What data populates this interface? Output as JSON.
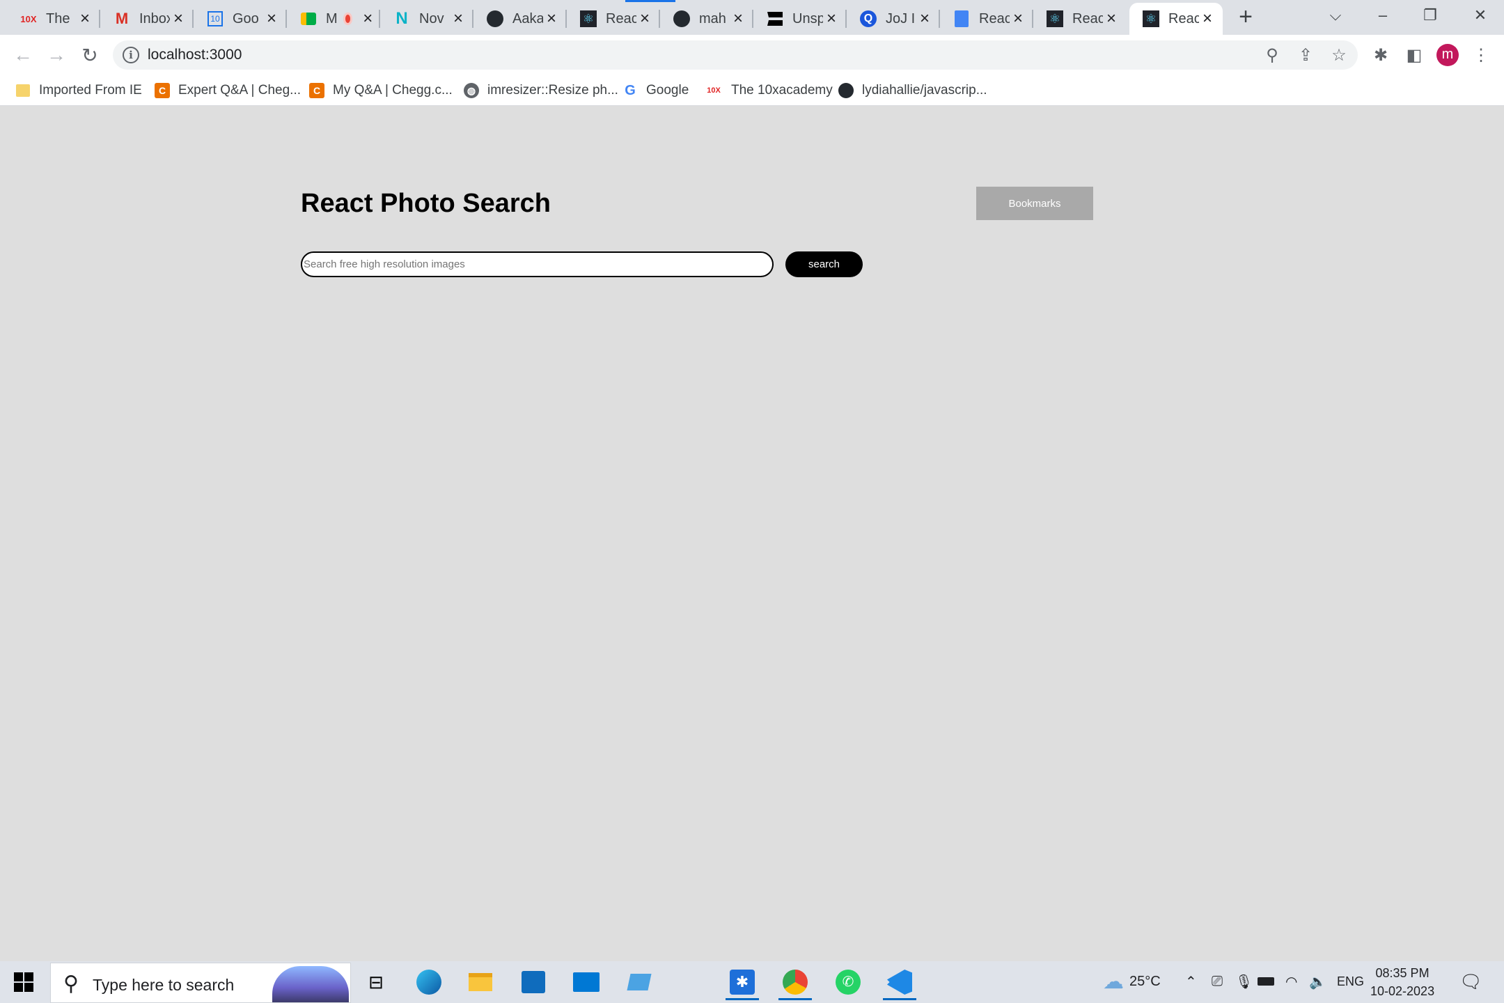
{
  "browser": {
    "tabs": [
      {
        "title": "The",
        "icon": "10x-logo-icon"
      },
      {
        "title": "Inbox",
        "icon": "gmail-icon"
      },
      {
        "title": "Goo",
        "icon": "google-calendar-icon"
      },
      {
        "title": "M",
        "icon": "google-meet-icon"
      },
      {
        "title": "Nov",
        "icon": "novu-icon"
      },
      {
        "title": "Aaka",
        "icon": "github-icon"
      },
      {
        "title": "Reac",
        "icon": "react-icon"
      },
      {
        "title": "mah",
        "icon": "github-icon"
      },
      {
        "title": "Unsp",
        "icon": "unsplash-icon"
      },
      {
        "title": "JoJ I",
        "icon": "quora-icon"
      },
      {
        "title": "Reac",
        "icon": "google-docs-icon"
      },
      {
        "title": "Reac",
        "icon": "react-icon"
      },
      {
        "title": "Reac",
        "icon": "react-icon"
      }
    ],
    "active_tab": 12,
    "url": "localhost:3000",
    "profile_initial": "m",
    "bookmarks": [
      {
        "label": "Imported From IE",
        "icon": "folder-icon"
      },
      {
        "label": "Expert Q&A | Cheg...",
        "icon": "chegg-icon"
      },
      {
        "label": "My Q&A | Chegg.c...",
        "icon": "chegg-icon"
      },
      {
        "label": "imresizer::Resize ph...",
        "icon": "globe-icon"
      },
      {
        "label": "Google",
        "icon": "google-icon"
      },
      {
        "label": "The 10xacademy",
        "icon": "10x-logo-icon"
      },
      {
        "label": "lydiahallie/javascrip...",
        "icon": "github-icon"
      }
    ]
  },
  "app": {
    "title": "React Photo Search",
    "bookmarks_button": "Bookmarks",
    "search_placeholder": "Search free high resolution images",
    "search_button": "search"
  },
  "taskbar": {
    "search_placeholder": "Type here to search",
    "temperature": "25°C",
    "language": "ENG",
    "time": "08:35 PM",
    "date": "10-02-2023"
  },
  "colors": {
    "page_background": "#dedede",
    "bookmarks_button_bg": "#a9a9a9",
    "search_button_bg": "#000000",
    "avatar_bg": "#c2185b"
  }
}
